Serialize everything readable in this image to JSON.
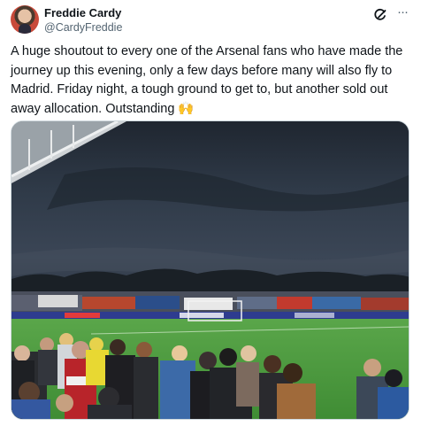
{
  "author": {
    "display_name": "Freddie Cardy",
    "handle": "@CardyFreddie"
  },
  "tweet": {
    "text": "A huge shoutout to every one of the Arsenal fans who have made the journey up this evening, only a few days before many will also fly to Madrid. Friday night, a tough ground to get to, but another sold out away allocation. Outstanding 🙌"
  },
  "icons": {
    "avatar": "profile-photo",
    "grok": "grok-icon",
    "more": "more-icon"
  },
  "colors": {
    "text_primary": "#0f1419",
    "text_secondary": "#536471",
    "border": "#cfd9de",
    "pitch": "#4a9a3c"
  }
}
